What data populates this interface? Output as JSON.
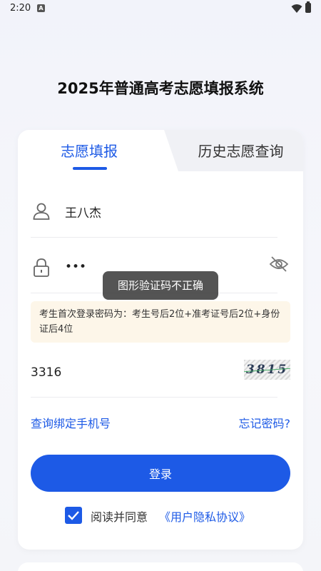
{
  "status_bar": {
    "time": "2:20",
    "notif_glyph": "A"
  },
  "title": "2025年普通高考志愿填报系统",
  "tabs": [
    {
      "label": "志愿填报",
      "active": true
    },
    {
      "label": "历史志愿查询",
      "active": false
    }
  ],
  "form": {
    "username": {
      "value": "王八杰",
      "icon": "user-icon"
    },
    "password": {
      "value": "•••",
      "icon": "lock-icon",
      "toggle_icon": "eye-off-icon"
    },
    "hint": "考生首次登录密码为：考生号后2位+准考证号后2位+身份证后4位",
    "captcha": {
      "value": "3316",
      "image_text": "3815"
    }
  },
  "toast": "图形验证码不正确",
  "links": {
    "bind_phone": "查询绑定手机号",
    "forgot_password": "忘记密码?"
  },
  "login_label": "登录",
  "agreement": {
    "checked": true,
    "text": "阅读并同意",
    "link": "《用户隐私协议》"
  },
  "colors": {
    "primary": "#1d5ae6",
    "hint_bg": "#fdf6e9"
  }
}
